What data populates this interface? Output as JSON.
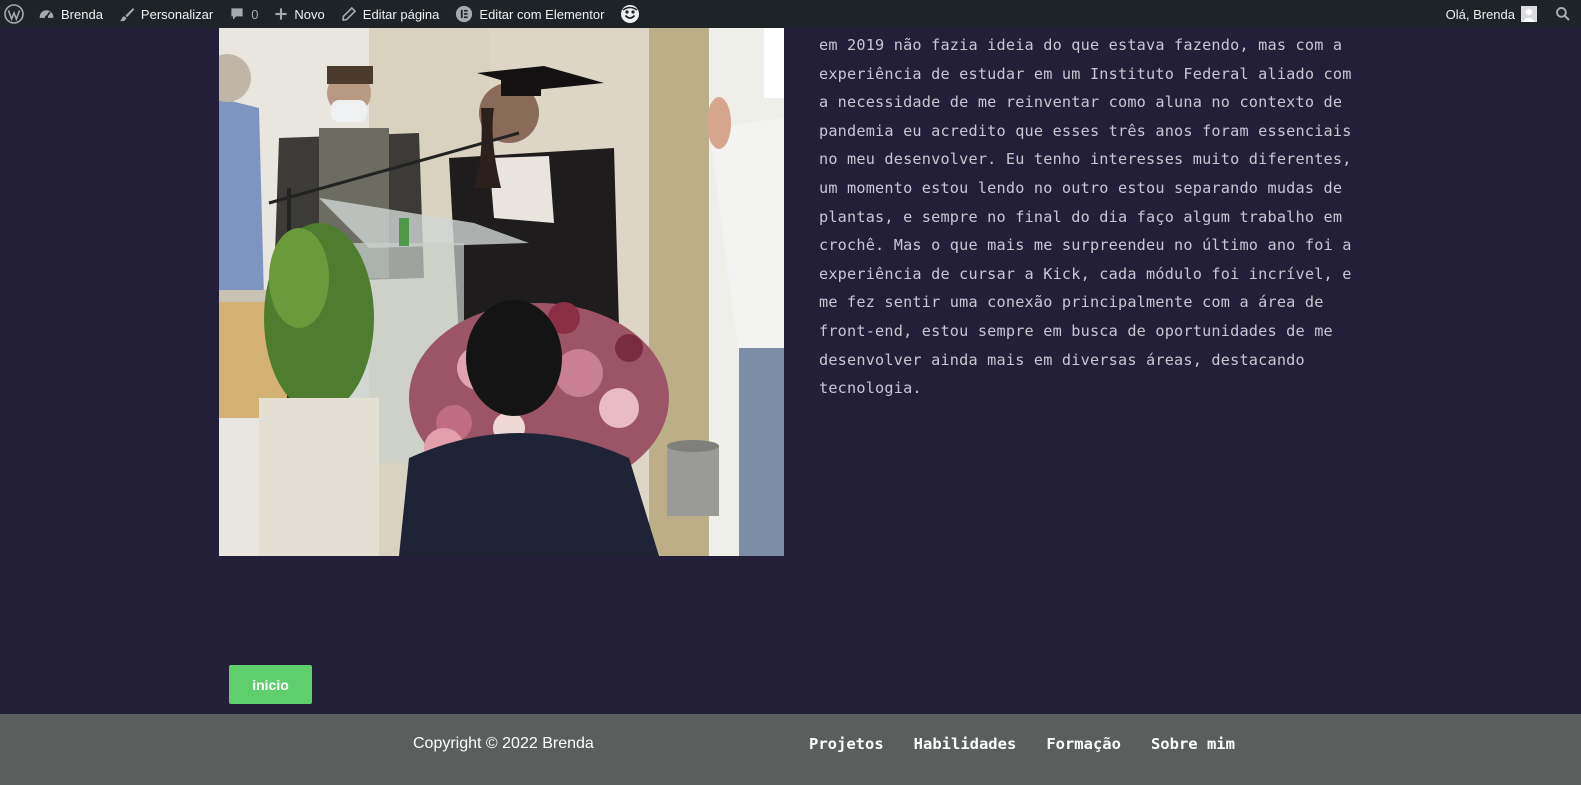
{
  "admin_bar": {
    "site_name": "Brenda",
    "customize_label": "Personalizar",
    "comments_count": "0",
    "new_label": "Novo",
    "edit_page_label": "Editar página",
    "edit_elementor_label": "Editar com Elementor",
    "greeting": "Olá, Brenda",
    "icons": {
      "wordpress": "wordpress-logo-icon",
      "site": "dashboard-icon",
      "customize": "paintbrush-icon",
      "comments": "comment-bubble-icon",
      "new": "plus-icon",
      "edit": "pencil-icon",
      "elementor": "elementor-icon",
      "extra": "smiley-icon",
      "search": "search-icon"
    }
  },
  "about": {
    "image_alt": "graduation-speech-photo",
    "text": "em 2019 não fazia ideia do que estava fazendo, mas com a experiência de estudar em um Instituto Federal aliado com a necessidade de me reinventar como aluna no contexto de pandemia eu acredito que esses três anos foram essenciais no meu desenvolver. Eu tenho interesses muito diferentes, um momento estou lendo no outro estou separando mudas de plantas, e sempre no final do dia faço algum trabalho em crochê. Mas o que mais me surpreendeu no último ano foi a experiência de cursar a Kick, cada módulo foi incrível, e me fez sentir uma conexão principalmente com a área de front-end,  estou sempre em busca de oportunidades de me desenvolver ainda mais em diversas áreas, destacando tecnologia."
  },
  "buttons": {
    "home_label": "inicio"
  },
  "footer": {
    "copyright": "Copyright © 2022 Brenda",
    "nav": [
      "Projetos",
      "Habilidades",
      "Formação",
      "Sobre mim"
    ]
  },
  "colors": {
    "page_bg": "#231f38",
    "admin_bar_bg": "#1d2327",
    "button_bg": "#5fce6d",
    "footer_bg": "#5a5f5e",
    "body_text": "#c9c7d3"
  }
}
